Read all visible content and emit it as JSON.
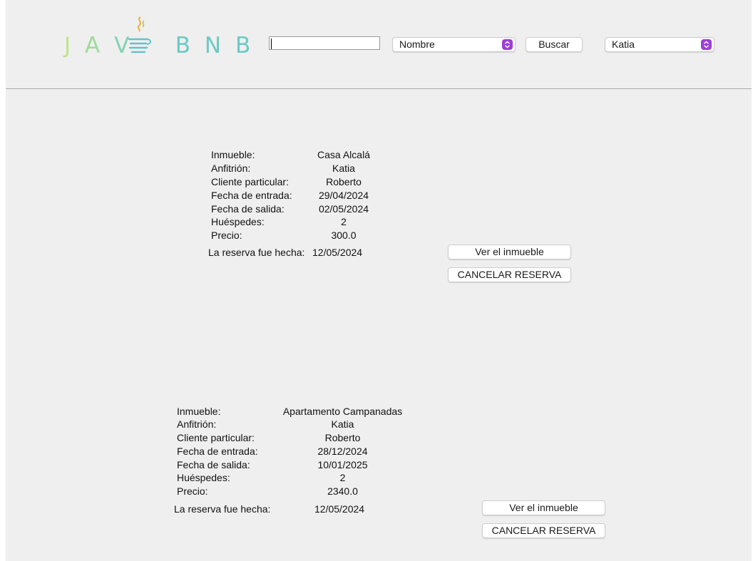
{
  "header": {
    "logo_text": "JAV BNB",
    "search": {
      "value": "",
      "placeholder": ""
    },
    "sort_select": {
      "selected": "Nombre"
    },
    "search_button_label": "Buscar",
    "user_select": {
      "selected": "Katia"
    }
  },
  "labels": {
    "inmueble": "Inmueble:",
    "anfitrion": "Anfitrión:",
    "cliente": "Cliente particular:",
    "entrada": "Fecha de entrada:",
    "salida": "Fecha de salida:",
    "huespedes": "Huéspedes:",
    "precio": "Precio:",
    "reserva_hecha": "La reserva fue hecha:"
  },
  "reservations": [
    {
      "inmueble": "Casa Alcalá",
      "anfitrion": "Katia",
      "cliente": "Roberto",
      "entrada": "29/04/2024",
      "salida": "02/05/2024",
      "huespedes": "2",
      "precio": "300.0",
      "reserva_hecha": "12/05/2024",
      "view_button_label": "Ver el inmueble",
      "cancel_button_label": "CANCELAR RESERVA"
    },
    {
      "inmueble": "Apartamento Campanadas",
      "anfitrion": "Katia",
      "cliente": "Roberto",
      "entrada": "28/12/2024",
      "salida": "10/01/2025",
      "huespedes": "2",
      "precio": "2340.0",
      "reserva_hecha": "12/05/2024",
      "view_button_label": "Ver el inmueble",
      "cancel_button_label": "CANCELAR RESERVA"
    }
  ],
  "colors": {
    "window_bg": "#efefef",
    "logo_green": "#bfe38a",
    "select_arrow_bg": "#9b3fd9"
  }
}
